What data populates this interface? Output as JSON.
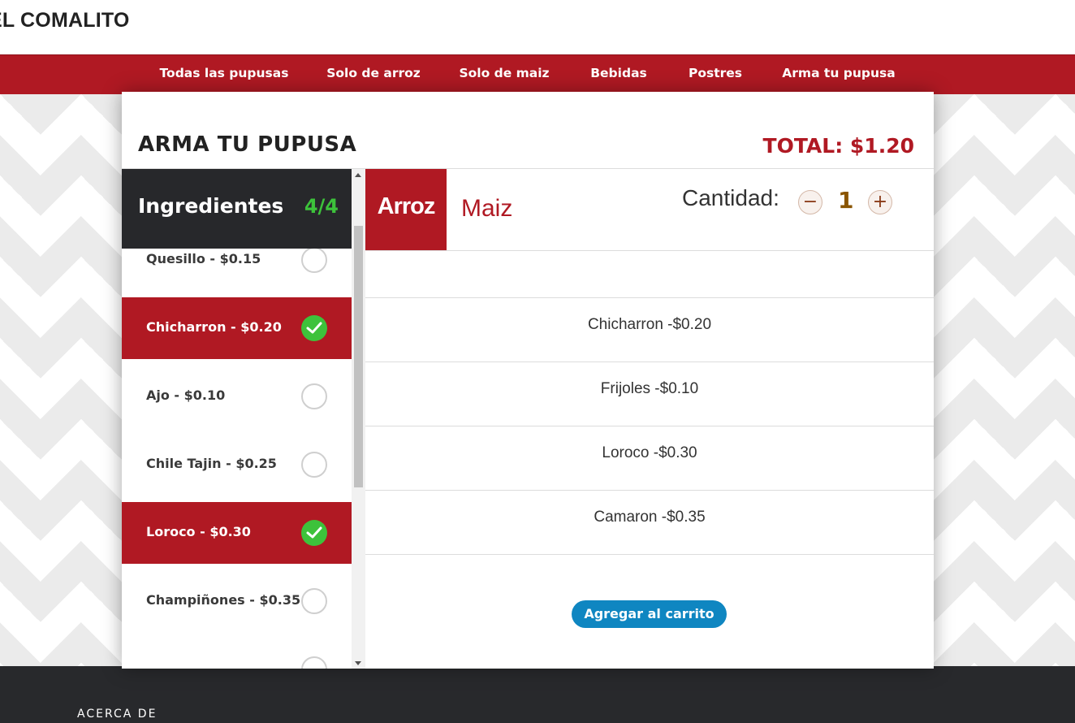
{
  "header": {
    "brand": "EL COMALITO"
  },
  "nav": {
    "items": [
      {
        "label": "Todas las pupusas"
      },
      {
        "label": "Solo de arroz"
      },
      {
        "label": "Solo de maiz"
      },
      {
        "label": "Bebidas"
      },
      {
        "label": "Postres"
      },
      {
        "label": "Arma tu pupusa"
      }
    ],
    "active": "Arma tu pupusa"
  },
  "modal": {
    "title": "ARMA TU PUPUSA",
    "total": "TOTAL: $1.20",
    "ingredients": {
      "heading": "Ingredientes",
      "count": "4/4",
      "items": [
        {
          "label": "Quesillo - $0.15",
          "selected": false
        },
        {
          "label": "Chicharron - $0.20",
          "selected": true
        },
        {
          "label": "Ajo - $0.10",
          "selected": false
        },
        {
          "label": "Chile Tajin - $0.25",
          "selected": false
        },
        {
          "label": "Loroco - $0.30",
          "selected": true
        },
        {
          "label": "Champiñones - $0.35",
          "selected": false
        }
      ]
    },
    "dough_tabs": {
      "arroz": "Arroz",
      "maiz": "Maiz",
      "selected": "Arroz"
    },
    "quantity": {
      "label": "Cantidad:",
      "value": "1",
      "minus": "−",
      "plus": "+"
    },
    "selected_list": [
      "Chicharron -$0.20",
      "Frijoles -$0.10",
      "Loroco -$0.30",
      "Camaron -$0.35"
    ],
    "add_to_cart": "Agregar al carrito"
  },
  "footer": {
    "section_label": "ACERCA DE"
  },
  "colors": {
    "brand_red": "#b01923",
    "check_green": "#3dc23b",
    "cart_blue": "#0f86c1",
    "dark": "#27282b"
  }
}
